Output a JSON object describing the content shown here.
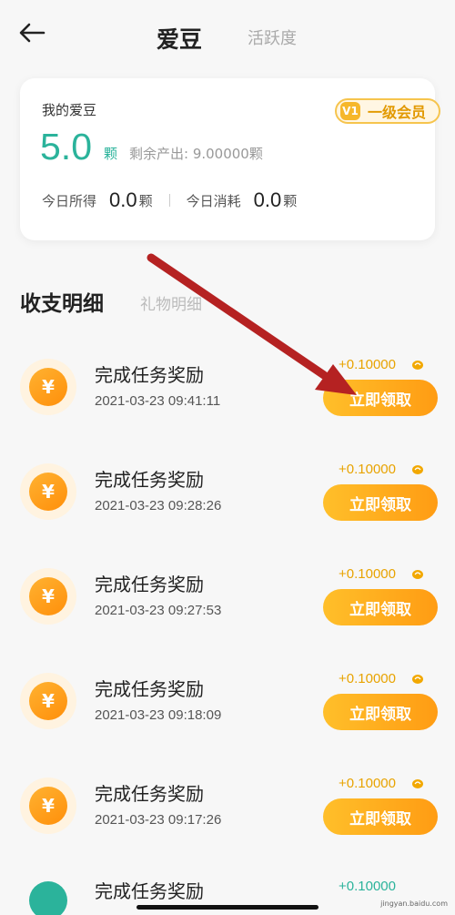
{
  "header": {
    "title": "爱豆",
    "tab_inactive": "活跃度"
  },
  "summary": {
    "label": "我的爱豆",
    "value": "5.0",
    "unit": "颗",
    "remaining": "剩余产出: 9.00000颗",
    "badge_text": "一级会员",
    "badge_icon": "V1",
    "today_earned_label": "今日所得",
    "today_earned_value": "0.0",
    "today_earned_unit": "颗",
    "today_spent_label": "今日消耗",
    "today_spent_value": "0.0",
    "today_spent_unit": "颗"
  },
  "sections": {
    "active": "收支明细",
    "inactive": "礼物明细"
  },
  "records": [
    {
      "title": "完成任务奖励",
      "time": "2021-03-23 09:41:11",
      "amount": "+0.10000",
      "button": "立即领取"
    },
    {
      "title": "完成任务奖励",
      "time": "2021-03-23 09:28:26",
      "amount": "+0.10000",
      "button": "立即领取"
    },
    {
      "title": "完成任务奖励",
      "time": "2021-03-23 09:27:53",
      "amount": "+0.10000",
      "button": "立即领取"
    },
    {
      "title": "完成任务奖励",
      "time": "2021-03-23 09:18:09",
      "amount": "+0.10000",
      "button": "立即领取"
    },
    {
      "title": "完成任务奖励",
      "time": "2021-03-23 09:17:26",
      "amount": "+0.10000",
      "button": "立即领取"
    }
  ],
  "partial_record": {
    "title": "完成任务奖励",
    "amount": "+0.10000"
  },
  "coin_symbol": "¥",
  "watermark": "jingyan.baidu.com",
  "colors": {
    "accent_green": "#2bb39b",
    "button_orange": "#ff9c13",
    "amount_gold": "#e8a300",
    "arrow_red": "#b52222"
  },
  "icons": [
    "back-arrow-icon",
    "yuan-coin-icon",
    "bean-icon",
    "vip-badge-icon"
  ]
}
